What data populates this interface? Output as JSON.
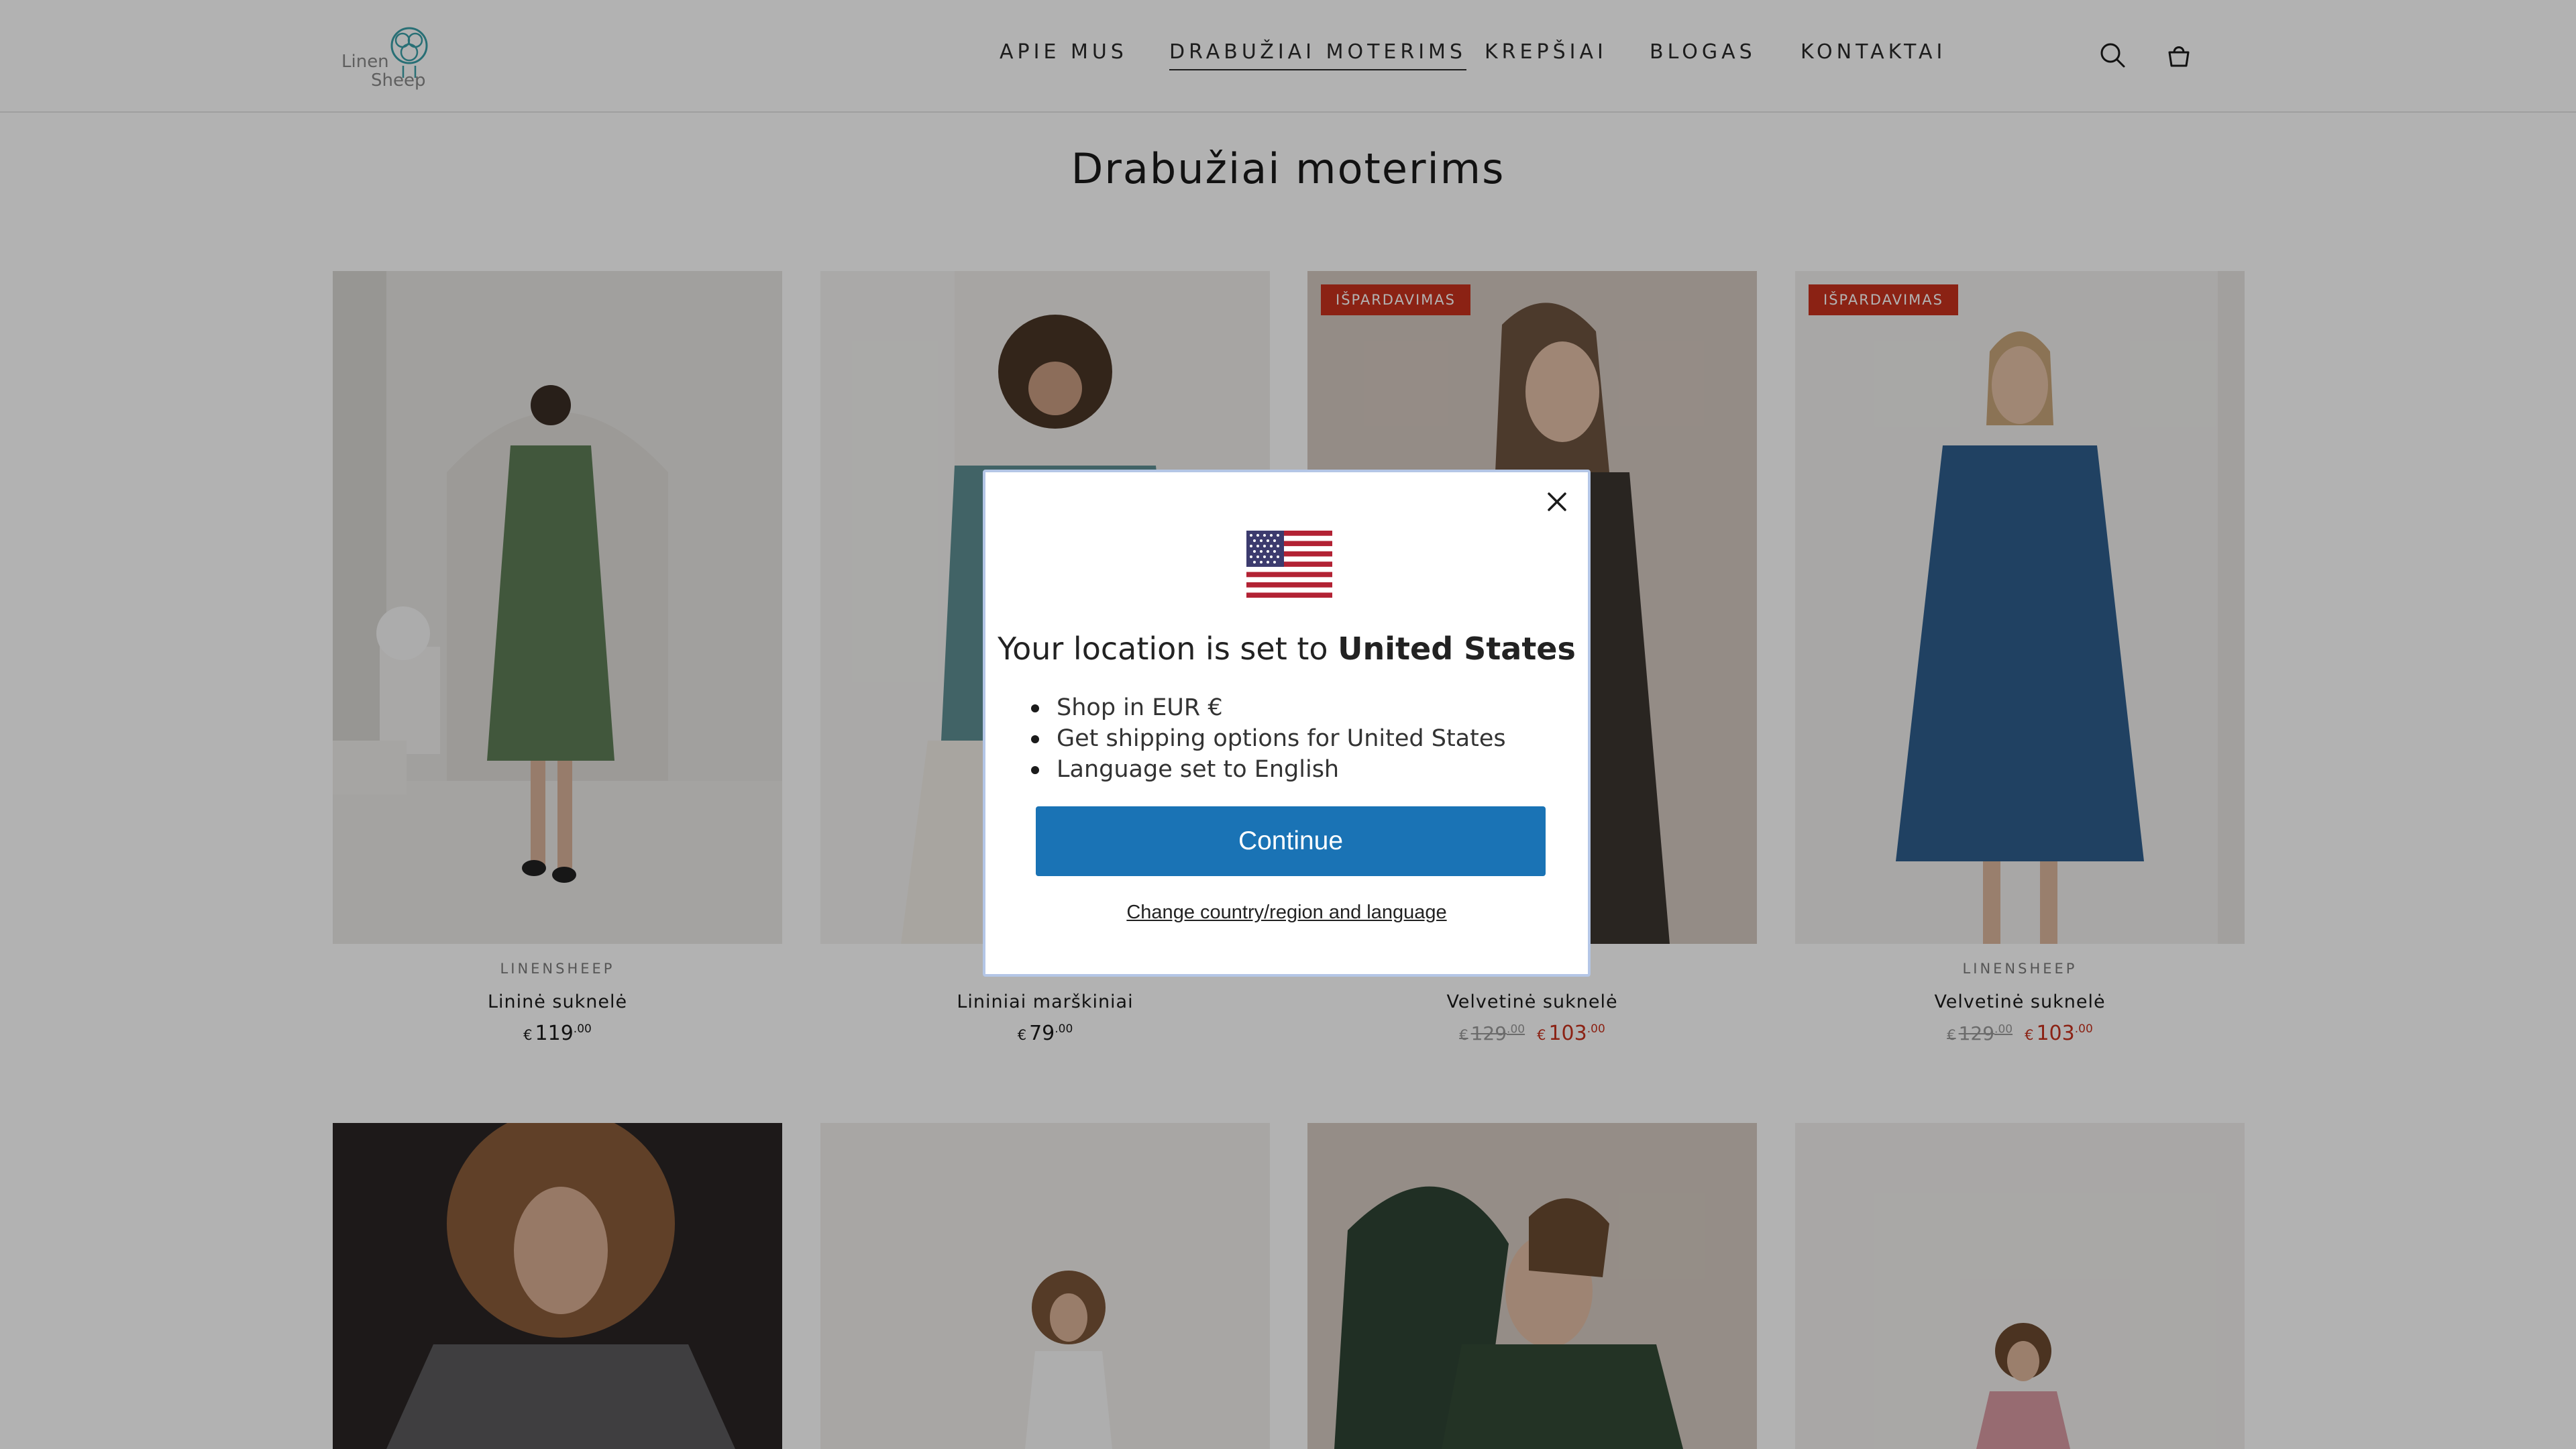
{
  "header": {
    "logo_text_1": "Linen",
    "logo_text_2": "Sheep",
    "nav": [
      {
        "label": "APIE MUS"
      },
      {
        "label": "DRABUŽIAI MOTERIMS",
        "active": true
      },
      {
        "label": "KREPŠIAI"
      },
      {
        "label": "BLOGAS"
      },
      {
        "label": "KONTAKTAI"
      }
    ],
    "icons": [
      "search-icon",
      "cart-icon"
    ]
  },
  "page_title": "Drabužiai moterims",
  "products": [
    {
      "vendor": "LINENSHEEP",
      "name": "Lininė suknelė",
      "currency": "€",
      "price": "119",
      "cents": ".00",
      "badge": "",
      "image": "green-linen-dress"
    },
    {
      "vendor": "LINENSHEEP",
      "name": "Lininiai marškiniai",
      "currency": "€",
      "price": "79",
      "cents": ".00",
      "badge": "",
      "image": "teal-linen-shirt"
    },
    {
      "vendor": "LINENSHEEP",
      "name": "Velvetinė suknelė",
      "currency": "€",
      "old_price": "129",
      "old_cents": ".00",
      "price": "103",
      "cents": ".00",
      "badge": "IŠPARDAVIMAS",
      "image": "dark-velvet-dress"
    },
    {
      "vendor": "LINENSHEEP",
      "name": "Velvetinė suknelė",
      "currency": "€",
      "old_price": "129",
      "old_cents": ".00",
      "price": "103",
      "cents": ".00",
      "badge": "IŠPARDAVIMAS",
      "image": "blue-velvet-dress"
    }
  ],
  "modal": {
    "title_prefix": "Your location is set to ",
    "title_country": "United States",
    "bullets": [
      "Shop in EUR €",
      "Get shipping options for United States",
      "Language set to English"
    ],
    "continue_label": "Continue",
    "change_label": "Change country/region and language",
    "flag": "us-flag-icon"
  },
  "colors": {
    "sale": "#c8321e",
    "continue_button": "#1a73b5",
    "overlay": "rgba(0,0,0,0.30)"
  }
}
